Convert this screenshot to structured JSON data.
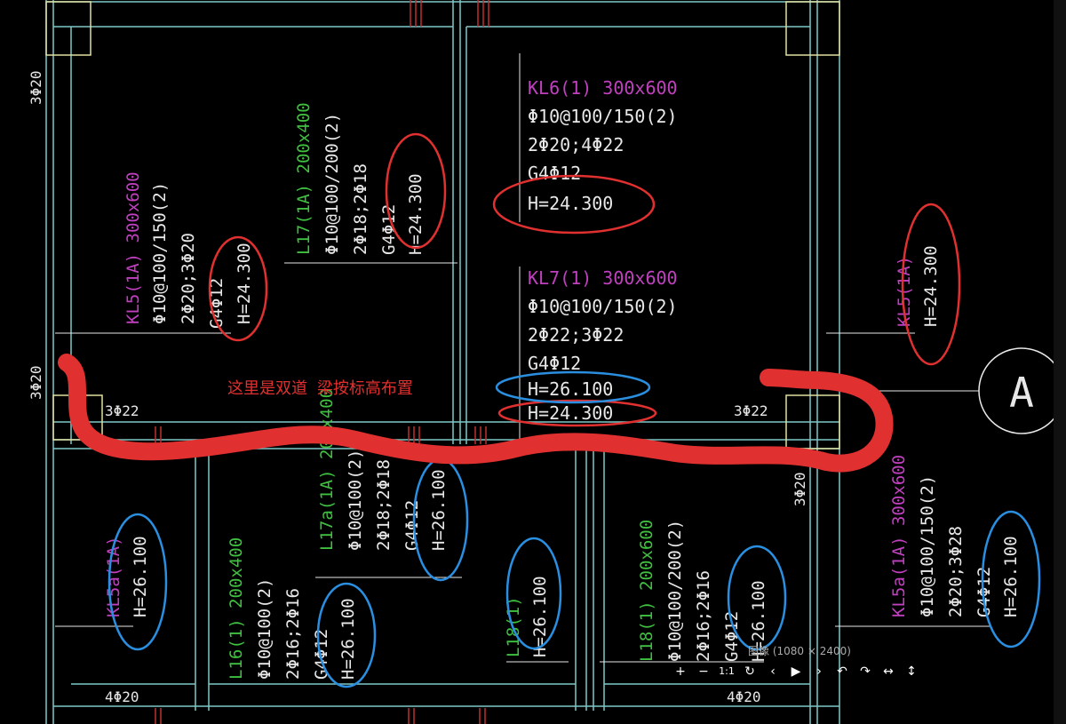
{
  "colors": {
    "background": "#000000",
    "wall_line": "#7fc7c7",
    "beam_magenta": "#c040c0",
    "beam_green": "#40c040",
    "text_white": "#e8e8e8",
    "red_mark": "#e03030",
    "blue_mark": "#2a8fe0",
    "rebar_red": "#c03030"
  },
  "annotation_note": "这里是双道 梁按标高布置",
  "axis_bubble": "A",
  "rebar_labels": {
    "top_left_vert": "3Φ20",
    "mid_left_vert": "3Φ20",
    "left_3phi22": "3Φ22",
    "right_3phi22": "3Φ22",
    "right_vert": "3Φ20",
    "bottom_left": "4Φ20",
    "bottom_right": "4Φ20"
  },
  "beams": {
    "kl6": {
      "name": "KL6(1) 300x600",
      "stirrup": "Φ10@100/150(2)",
      "main": "2Φ20;4Φ22",
      "side": "G4Φ12",
      "h": "H=24.300"
    },
    "kl7": {
      "name": "KL7(1) 300x600",
      "stirrup": "Φ10@100/150(2)",
      "main": "2Φ22;3Φ22",
      "side": "G4Φ12",
      "h1": "H=26.100",
      "h2": "H=24.300"
    },
    "kl5_left": {
      "name": "KL5(1A) 300x600",
      "stirrup": "Φ10@100/150(2)",
      "main": "2Φ20;3Φ20",
      "side": "G4Φ12",
      "h": "H=24.300"
    },
    "l17": {
      "name": "L17(1A) 200x400",
      "stirrup": "Φ10@100/200(2)",
      "main": "2Φ18;2Φ18",
      "side": "G4Φ12",
      "h": "H=24.300"
    },
    "kl5_right": {
      "name": "KL5(1A)",
      "h": "H=24.300"
    },
    "kl5a_left": {
      "name": "KL5a(1A)",
      "h": "H=26.100"
    },
    "l17a": {
      "name": "L17a(1A) 200x400",
      "stirrup": "Φ10@100(2)",
      "main": "2Φ18;2Φ18",
      "side": "G4Φ12",
      "h": "H=26.100"
    },
    "l16": {
      "name": "L16(1) 200x400",
      "stirrup": "Φ10@100(2)",
      "main": "2Φ16;2Φ16",
      "side": "G4Φ12",
      "h": "H=26.100"
    },
    "l18_small": {
      "name": "L18(1)",
      "h": "H=26.100"
    },
    "l18": {
      "name": "L18(1) 200x600",
      "stirrup": "Φ10@100/200(2)",
      "main": "2Φ16;2Φ16",
      "side": "G4Φ12",
      "h": "H=26.100"
    },
    "kl5a_right": {
      "name": "KL5a(1A) 300x600",
      "stirrup": "Φ10@100/150(2)",
      "main": "2Φ20;3Φ28",
      "side": "G4Φ12",
      "h": "H=26.100"
    }
  },
  "viewer": {
    "image_info": "图像 (1080 × 2400)",
    "buttons": [
      "+",
      "−",
      "1:1",
      "↻",
      "‹",
      "▶",
      "›",
      "↶",
      "↷",
      "↔",
      "↕"
    ]
  }
}
